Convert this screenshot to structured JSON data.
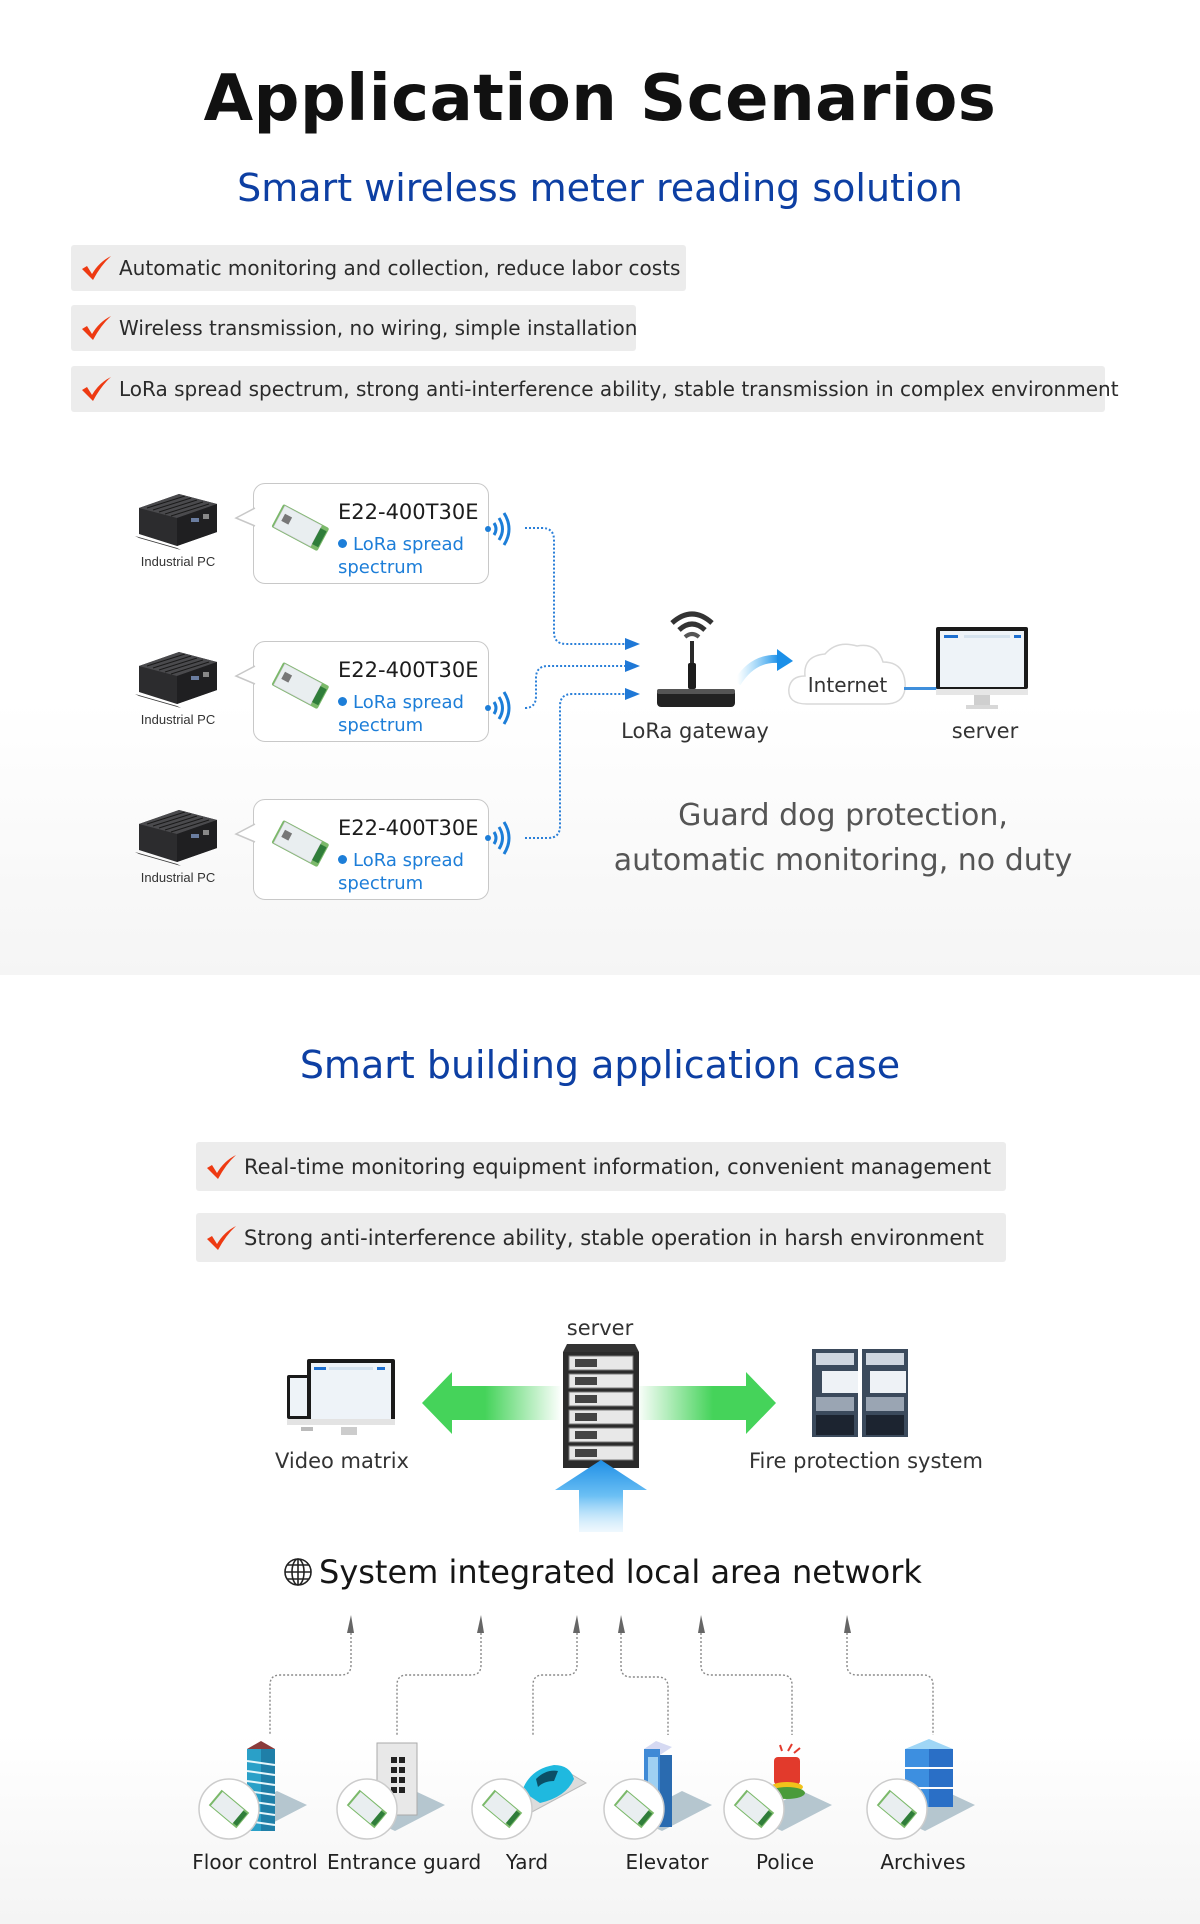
{
  "page": {
    "title": "Application Scenarios"
  },
  "meter_reading": {
    "subtitle": "Smart wireless meter reading solution",
    "bullets": [
      "Automatic monitoring and collection, reduce labor costs",
      "Wireless transmission, no wiring, simple installation",
      "LoRa spread spectrum, strong anti-interference ability, stable transmission in complex environment"
    ],
    "nodes": [
      {
        "device_label": "Industrial PC",
        "module_model": "E22-400T30E",
        "feature": "LoRa spread spectrum"
      },
      {
        "device_label": "Industrial PC",
        "module_model": "E22-400T30E",
        "feature": "LoRa spread spectrum"
      },
      {
        "device_label": "Industrial PC",
        "module_model": "E22-400T30E",
        "feature": "LoRa spread spectrum"
      }
    ],
    "gateway_label": "LoRa gateway",
    "cloud_label": "Internet",
    "server_label": "server",
    "tagline_line1": "Guard dog protection,",
    "tagline_line2": "automatic monitoring, no duty"
  },
  "smart_building": {
    "subtitle": "Smart building application case",
    "bullets": [
      "Real-time monitoring equipment information, convenient management",
      "Strong anti-interference ability, stable operation in harsh environment"
    ],
    "server_label": "server",
    "video_label": "Video matrix",
    "fire_label": "Fire protection system",
    "lan_title": "System integrated local area network",
    "devices": [
      {
        "label": "Floor control",
        "icon": "building-icon"
      },
      {
        "label": "Entrance guard",
        "icon": "keypad-icon"
      },
      {
        "label": "Yard",
        "icon": "car-icon"
      },
      {
        "label": "Elevator",
        "icon": "elevator-icon"
      },
      {
        "label": "Police",
        "icon": "alarm-light-icon"
      },
      {
        "label": "Archives",
        "icon": "database-icon"
      }
    ]
  },
  "colors": {
    "accent_blue": "#0d3fa3",
    "link_blue": "#1d7ed8",
    "check_red": "#ee3a12",
    "bullet_bg": "#ececec",
    "arrow_green": "#4cd964"
  }
}
